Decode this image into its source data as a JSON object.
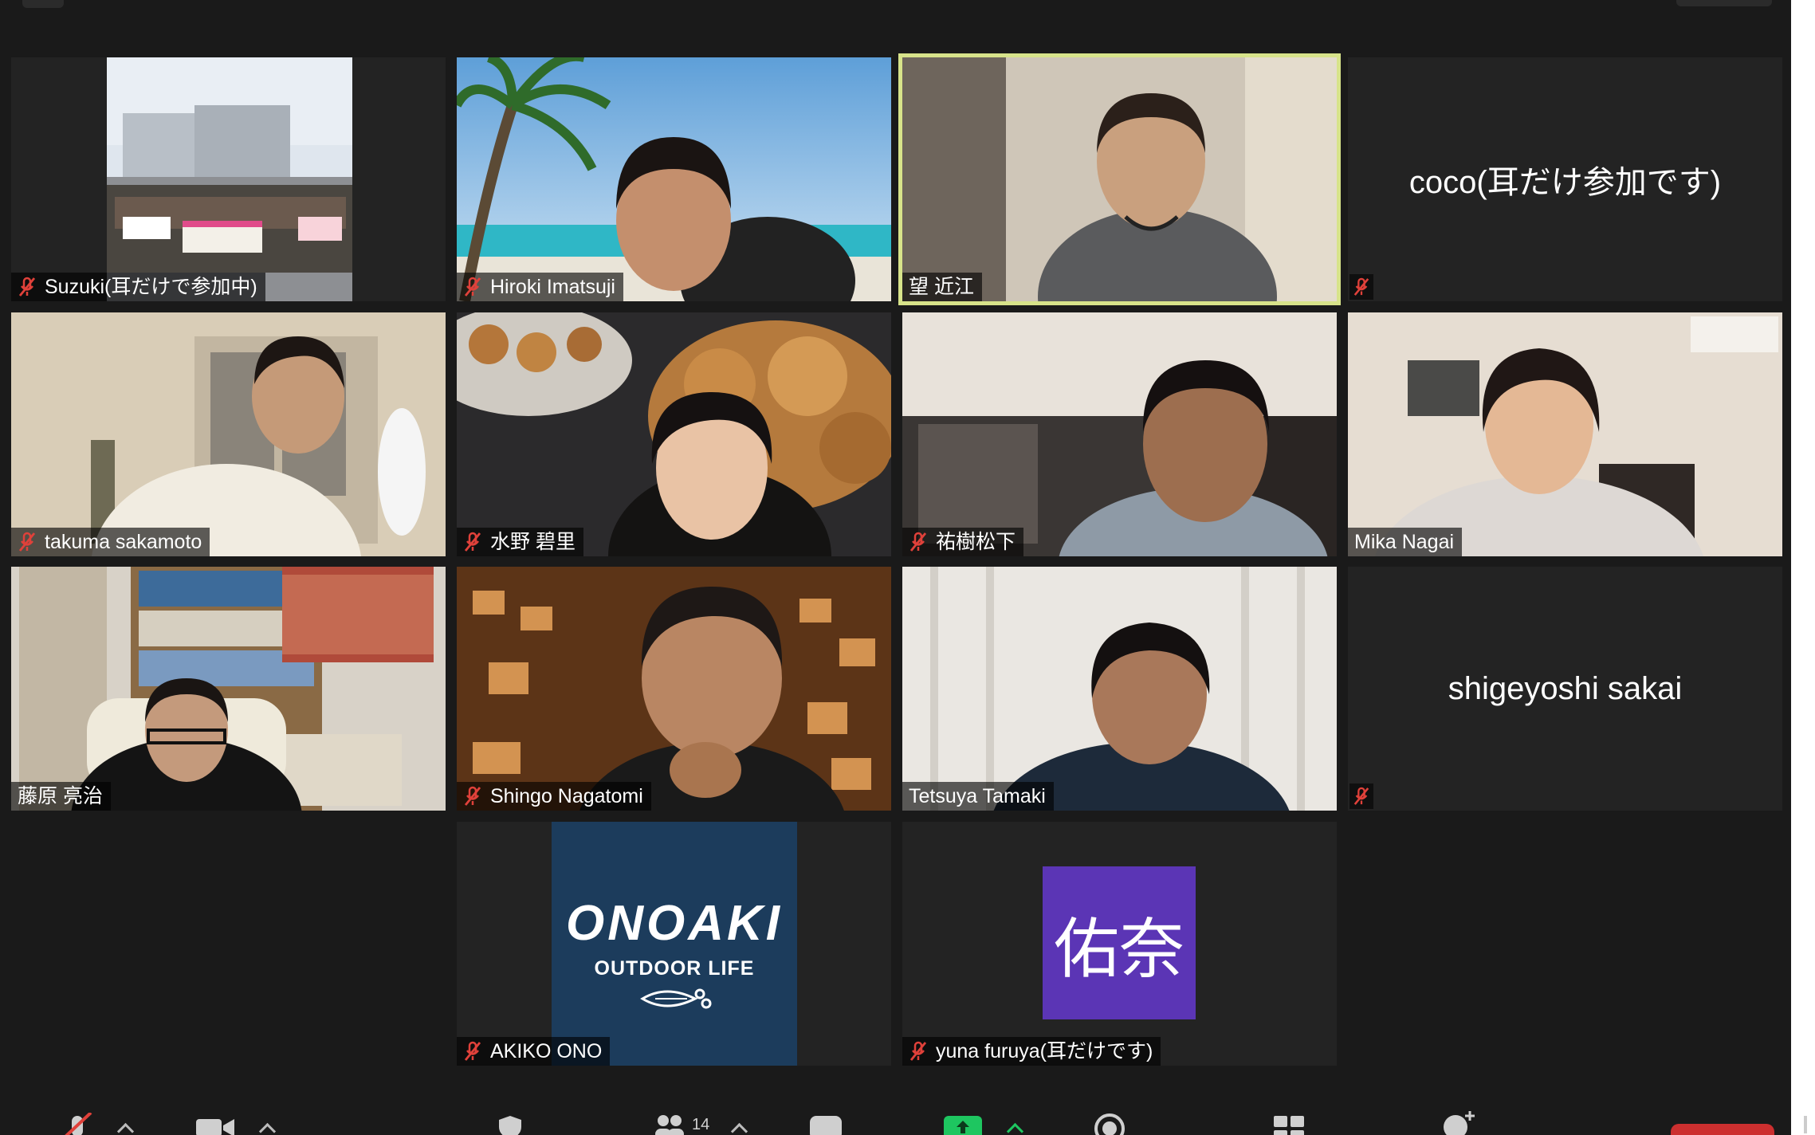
{
  "participants": [
    {
      "name": "Suzuki(耳だけで参加中)",
      "muted": true
    },
    {
      "name": "Hiroki Imatsuji",
      "muted": true
    },
    {
      "name": "望 近江",
      "muted": false,
      "active_speaker": true
    },
    {
      "name": "coco(耳だけ参加です)",
      "muted": true,
      "video": false
    },
    {
      "name": "takuma sakamoto",
      "muted": true
    },
    {
      "name": "水野 碧里",
      "muted": true
    },
    {
      "name": "祐樹松下",
      "muted": true
    },
    {
      "name": "Mika Nagai",
      "muted": false
    },
    {
      "name": "藤原 亮治",
      "muted": false
    },
    {
      "name": "Shingo Nagatomi",
      "muted": true
    },
    {
      "name": "Tetsuya Tamaki",
      "muted": false
    },
    {
      "name": "shigeyoshi sakai",
      "muted": true,
      "video": false
    },
    {
      "name": "AKIKO ONO",
      "muted": true
    },
    {
      "name": "yuna furuya(耳だけです)",
      "muted": true
    }
  ],
  "logo": {
    "wordmark": "ONOAKI",
    "tagline": "OUTDOOR LIFE"
  },
  "avatar": {
    "initials": "佑奈",
    "color": "#5b35b5"
  },
  "colors": {
    "background": "#1a1a1a",
    "tile": "#232323",
    "active_border": "#d7e38a",
    "muted_icon": "#e0413a",
    "end": "#cc2f2f"
  },
  "toolbar": {
    "participants_count": "14"
  }
}
